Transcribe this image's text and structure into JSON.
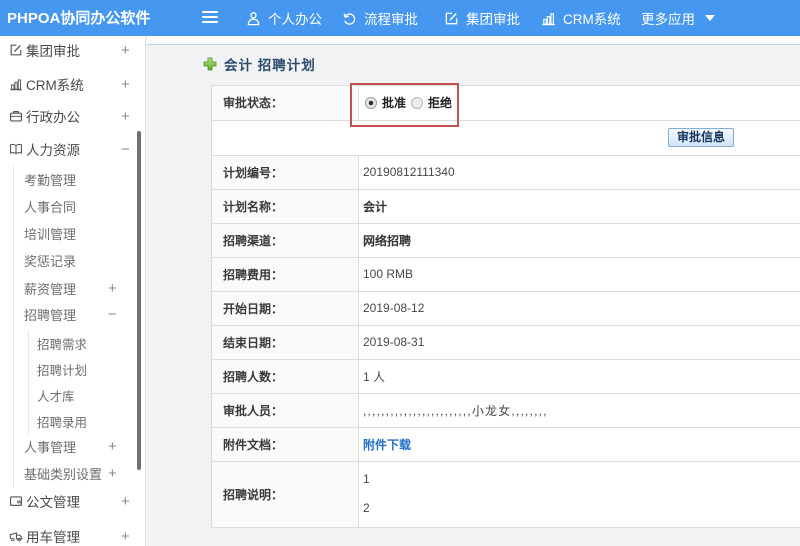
{
  "topbar": {
    "logo": "PHPOA协同办公软件",
    "nav": [
      {
        "label": "个人办公",
        "icon": "user-icon"
      },
      {
        "label": "流程审批",
        "icon": "process-approval-icon"
      },
      {
        "label": "集团审批",
        "icon": "edit-square-icon"
      },
      {
        "label": "CRM系统",
        "icon": "bar-chart-icon"
      },
      {
        "label": "更多应用",
        "icon": "caret-down-icon"
      }
    ]
  },
  "sidebar": {
    "items": [
      {
        "label": "集团审批",
        "level": 1,
        "icon": "edit-square-icon",
        "toggle": "+"
      },
      {
        "label": "CRM系统",
        "level": 1,
        "icon": "bar-chart-icon",
        "toggle": "+"
      },
      {
        "label": "行政办公",
        "level": 1,
        "icon": "briefcase-icon",
        "toggle": "+"
      },
      {
        "label": "人力资源",
        "level": 1,
        "icon": "open-book-icon",
        "toggle": "−"
      },
      {
        "label": "考勤管理",
        "level": 2,
        "toggle": ""
      },
      {
        "label": "人事合同",
        "level": 2,
        "toggle": ""
      },
      {
        "label": "培训管理",
        "level": 2,
        "toggle": ""
      },
      {
        "label": "奖惩记录",
        "level": 2,
        "toggle": ""
      },
      {
        "label": "薪资管理",
        "level": 2,
        "toggle": "+"
      },
      {
        "label": "招聘管理",
        "level": 2,
        "toggle": "−"
      },
      {
        "label": "招聘需求",
        "level": 3,
        "toggle": ""
      },
      {
        "label": "招聘计划",
        "level": 3,
        "toggle": ""
      },
      {
        "label": "人才库",
        "level": 3,
        "toggle": ""
      },
      {
        "label": "招聘录用",
        "level": 3,
        "toggle": ""
      },
      {
        "label": "人事管理",
        "level": 2,
        "toggle": "+"
      },
      {
        "label": "基础类别设置",
        "level": 2,
        "toggle": "+"
      },
      {
        "label": "公文管理",
        "level": 1,
        "icon": "folder-icon",
        "toggle": "+"
      },
      {
        "label": "用车管理",
        "level": 1,
        "icon": "truck-icon",
        "toggle": "+"
      }
    ]
  },
  "breadcrumb": {
    "title": "会计 招聘计划"
  },
  "form": {
    "approval_status_label": "审批状态：",
    "radio_approve": "批准",
    "radio_reject": "拒绝",
    "approval_info_button": "审批信息",
    "rows": [
      {
        "label": "计划编号：",
        "value": "20190812111340"
      },
      {
        "label": "计划名称：",
        "value": "会计"
      },
      {
        "label": "招聘渠道：",
        "value": "网络招聘"
      },
      {
        "label": "招聘费用：",
        "value": "100 RMB"
      },
      {
        "label": "开始日期：",
        "value": "2019-08-12"
      },
      {
        "label": "结束日期：",
        "value": "2019-08-31"
      },
      {
        "label": "招聘人数：",
        "value": "1 人"
      },
      {
        "label": "审批人员：",
        "value": ",,,,,,,,,,,,,,,,,,,,,,,,小龙女,,,,,,,,"
      },
      {
        "label": "附件文档：",
        "value": "附件下载"
      },
      {
        "label": "招聘说明：",
        "line1": "1",
        "line2": "2"
      }
    ]
  },
  "colors": {
    "topbar_blue": "#4697f0",
    "annotation_red": "#c2504e",
    "link_blue": "#2570c7",
    "breadcrumb_navy": "#2b4a6d",
    "plus_green": "#6fbe44"
  }
}
